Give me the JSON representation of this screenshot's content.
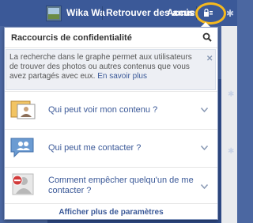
{
  "topbar": {
    "user_name": "Wika Wa",
    "find_friends": "Retrouver des amis",
    "home": "Accueil",
    "icons": [
      "lock-icon",
      "gear-icon"
    ],
    "highlight_color": "#f5b91e",
    "bar_color": "#3b5998"
  },
  "dropdown": {
    "title": "Raccourcis de confidentialité",
    "info": {
      "text": "La recherche dans le graphe permet aux utilisateurs de trouver des photos ou autres contenus que vous avez partagés avec eux.",
      "link": "En savoir plus"
    },
    "rows": [
      {
        "label": "Qui peut voir mon contenu ?",
        "icon": "content-visibility-icon"
      },
      {
        "label": "Qui peut me contacter ?",
        "icon": "contact-icon"
      },
      {
        "label": "Comment empêcher quelqu'un de me contacter ?",
        "icon": "block-user-icon"
      }
    ],
    "footer_link": "Afficher plus de paramètres"
  }
}
